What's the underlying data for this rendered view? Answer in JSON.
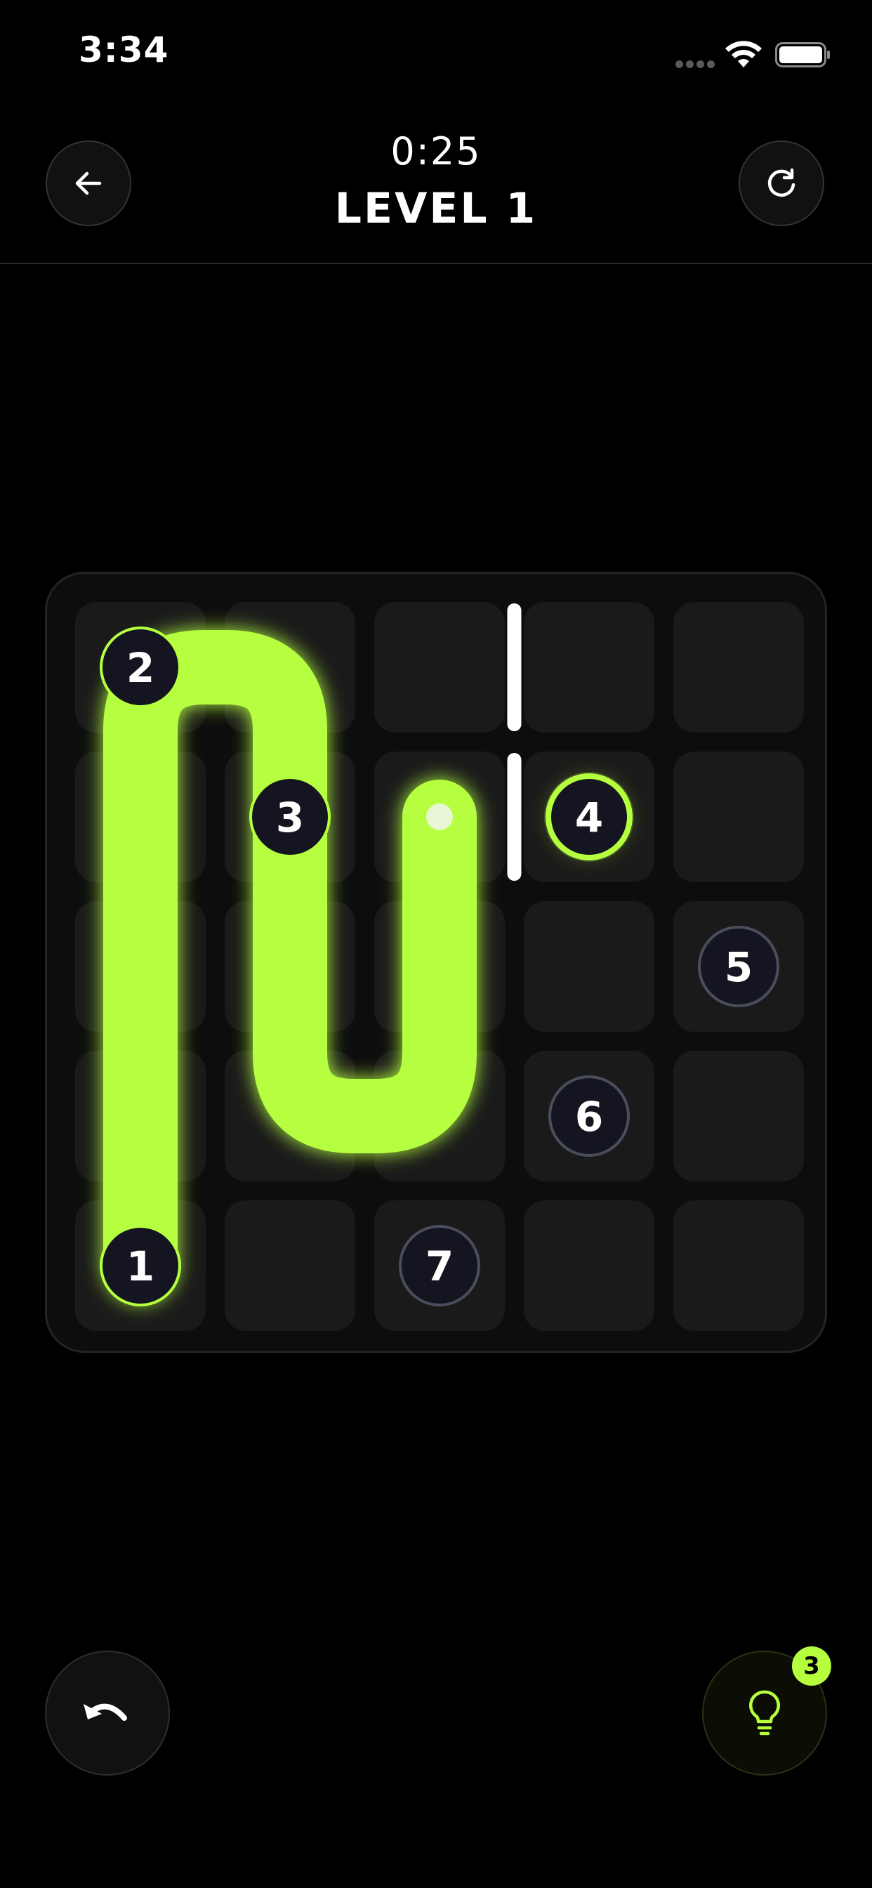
{
  "status_bar": {
    "time": "3:34"
  },
  "header": {
    "timer": "0:25",
    "level_title": "LEVEL 1",
    "back_icon": "arrow-left-icon",
    "restart_icon": "refresh-icon"
  },
  "board": {
    "rows": 5,
    "cols": 5,
    "cell_color": "#1a1a1a",
    "path_color": "#b5ff3f",
    "nodes": [
      {
        "label": "1",
        "row": 4,
        "col": 0,
        "state": "visited"
      },
      {
        "label": "2",
        "row": 0,
        "col": 0,
        "state": "visited"
      },
      {
        "label": "3",
        "row": 1,
        "col": 1,
        "state": "visited"
      },
      {
        "label": "4",
        "row": 1,
        "col": 3,
        "state": "next"
      },
      {
        "label": "5",
        "row": 2,
        "col": 4,
        "state": "pending"
      },
      {
        "label": "6",
        "row": 3,
        "col": 3,
        "state": "pending"
      },
      {
        "label": "7",
        "row": 4,
        "col": 2,
        "state": "pending"
      }
    ],
    "path": [
      [
        4,
        0
      ],
      [
        3,
        0
      ],
      [
        2,
        0
      ],
      [
        1,
        0
      ],
      [
        0,
        0
      ],
      [
        0,
        1
      ],
      [
        1,
        1
      ],
      [
        2,
        1
      ],
      [
        3,
        1
      ],
      [
        3,
        2
      ],
      [
        2,
        2
      ],
      [
        1,
        2
      ]
    ],
    "walls": [
      {
        "between": [
          [
            0,
            2
          ],
          [
            0,
            3
          ]
        ]
      },
      {
        "between": [
          [
            1,
            2
          ],
          [
            1,
            3
          ]
        ]
      }
    ]
  },
  "controls": {
    "undo_icon": "undo-icon",
    "hint_icon": "lightbulb-icon",
    "hints_remaining": "3"
  }
}
